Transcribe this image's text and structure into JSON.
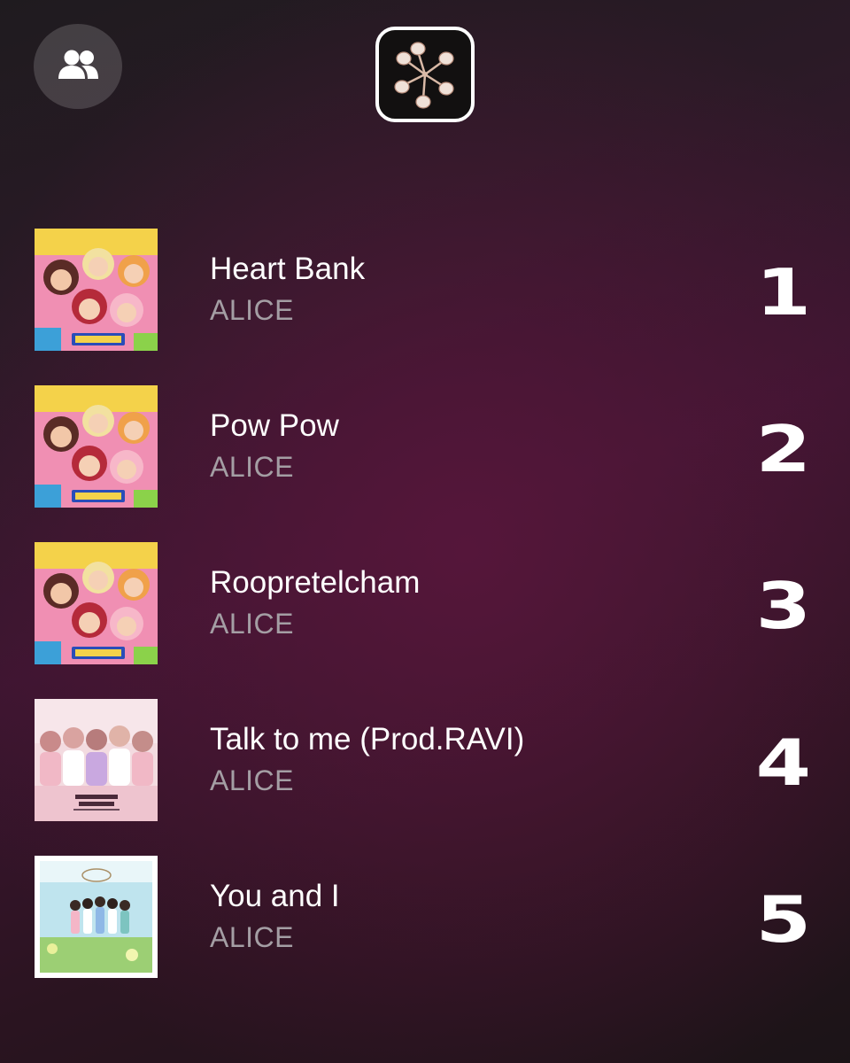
{
  "header": {
    "friends_icon": "friends-icon",
    "cover_icon": "playlist-cover"
  },
  "tracks": [
    {
      "rank": "1",
      "title": "Heart Bank",
      "artist": "ALICE",
      "art": "crush-album-art"
    },
    {
      "rank": "2",
      "title": "Pow Pow",
      "artist": "ALICE",
      "art": "crush-album-art"
    },
    {
      "rank": "3",
      "title": "Roopretelcham",
      "artist": "ALICE",
      "art": "crush-album-art"
    },
    {
      "rank": "4",
      "title": "Talk to me (Prod.RAVI)",
      "artist": "ALICE",
      "art": "summer-dream-album-art"
    },
    {
      "rank": "5",
      "title": "You and I",
      "artist": "ALICE",
      "art": "elris-album-art"
    }
  ]
}
